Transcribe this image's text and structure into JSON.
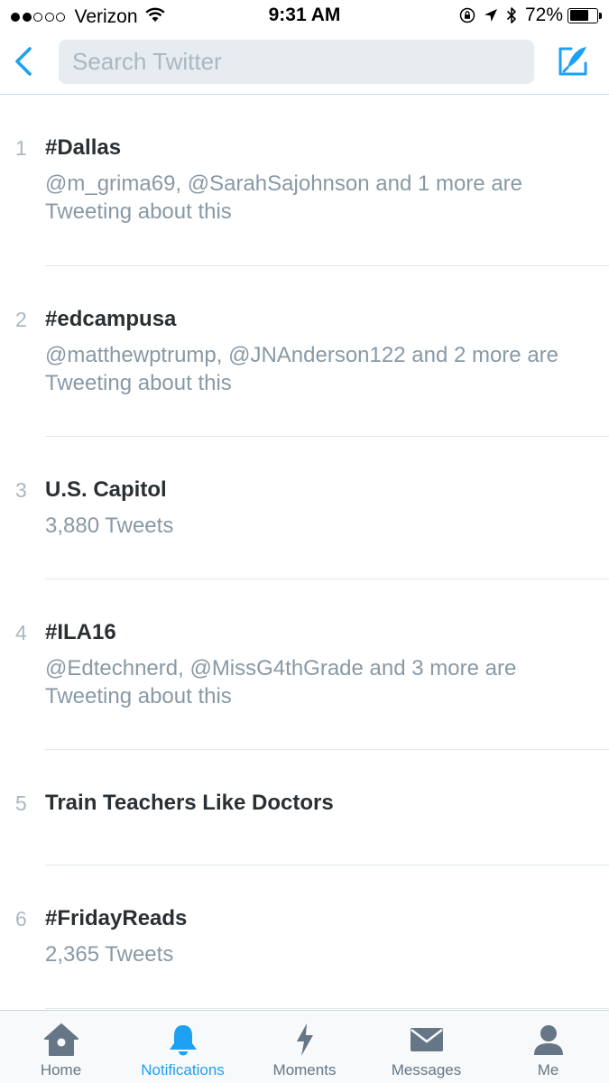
{
  "status_bar": {
    "carrier": "Verizon",
    "signal_bars_filled": 2,
    "signal_bars_total": 5,
    "time": "9:31 AM",
    "battery_percent": "72%",
    "battery_level": 0.72
  },
  "search": {
    "placeholder": "Search Twitter"
  },
  "colors": {
    "accent": "#1da1f2",
    "tab_inactive": "#657786",
    "meta_text": "#8899a6"
  },
  "trends": [
    {
      "rank": "1",
      "name": "#Dallas",
      "meta": "@m_grima69, @SarahSajohnson and 1 more are Tweeting about this"
    },
    {
      "rank": "2",
      "name": "#edcampusa",
      "meta": "@matthewptrump, @JNAnderson122 and 2 more are Tweeting about this"
    },
    {
      "rank": "3",
      "name": "U.S. Capitol",
      "meta": "3,880 Tweets"
    },
    {
      "rank": "4",
      "name": "#ILA16",
      "meta": "@Edtechnerd, @MissG4thGrade and 3 more are Tweeting about this"
    },
    {
      "rank": "5",
      "name": "Train Teachers Like Doctors",
      "meta": ""
    },
    {
      "rank": "6",
      "name": "#FridayReads",
      "meta": "2,365 Tweets"
    }
  ],
  "tabs": [
    {
      "label": "Home",
      "icon": "home-icon",
      "active": false
    },
    {
      "label": "Notifications",
      "icon": "bell-icon",
      "active": true
    },
    {
      "label": "Moments",
      "icon": "lightning-icon",
      "active": false
    },
    {
      "label": "Messages",
      "icon": "envelope-icon",
      "active": false
    },
    {
      "label": "Me",
      "icon": "person-icon",
      "active": false
    }
  ]
}
